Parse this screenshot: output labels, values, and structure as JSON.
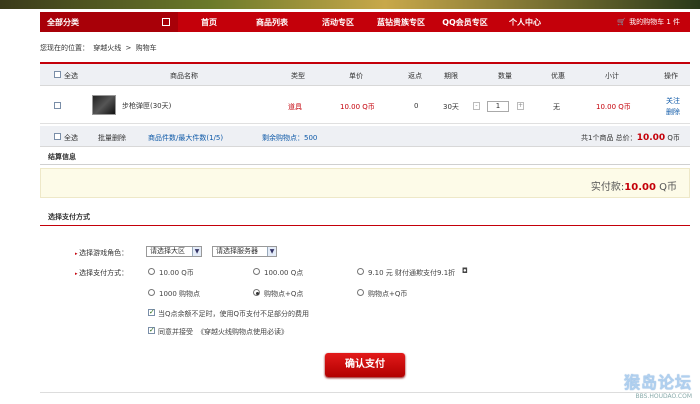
{
  "nav": {
    "category": "全部分类",
    "items": [
      "首页",
      "商品列表",
      "活动专区",
      "蓝钻贵族专区",
      "QQ会员专区",
      "个人中心"
    ],
    "cart": "我的购物车 1 件"
  },
  "breadcrumb": {
    "prefix": "您现在的位置：",
    "site": "穿越火线",
    "sep": ">",
    "page": "购物车"
  },
  "table": {
    "select_all": "全选",
    "headers": [
      "商品名称",
      "类型",
      "单价",
      "返点",
      "期限",
      "数量",
      "优惠",
      "小计",
      "操作"
    ],
    "row": {
      "name": "步枪弹匣(30天)",
      "type": "道具",
      "price": "10.00 Q币",
      "rebate": "0",
      "term": "30天",
      "qty": "1",
      "discount": "无",
      "subtotal": "10.00 Q币",
      "op_follow": "关注",
      "op_delete": "删除"
    },
    "foot": {
      "select_all": "全选",
      "batch_delete": "批量删除",
      "item_count": "商品件数/最大件数(1/5)",
      "remaining": "剩余购物点：500",
      "summary_prefix": "共1个商品 总价：",
      "total": "10.00",
      "unit": "Q币"
    }
  },
  "settlement": {
    "title": "结算信息",
    "paid_label": "实付款:",
    "paid_value": "10.00",
    "paid_unit": "Q币"
  },
  "payment": {
    "title": "选择支付方式",
    "role_label": "选择游戏角色：",
    "region_placeholder": "请选择大区",
    "server_placeholder": "请选择服务器",
    "method_label": "选择支付方式：",
    "options": [
      "10.00 Q币",
      "100.00 Q点",
      "9.10 元 财付通欺支付9.1折",
      "1000 购物点",
      "购物点+Q点",
      "购物点+Q币"
    ],
    "selected_index": 4,
    "check1": "当Q点余额不足时，使用Q币支付不足部分的费用",
    "check2_prefix": "同意并接受",
    "check2_link": "《穿越火线购物点使用必读》",
    "confirm": "确认支付"
  },
  "watermark": {
    "main": "猴岛论坛",
    "sub": "BBS.HOUDAO.COM"
  },
  "colors": {
    "brand_red": "#c4000a",
    "link_blue": "#0f5aa8"
  }
}
